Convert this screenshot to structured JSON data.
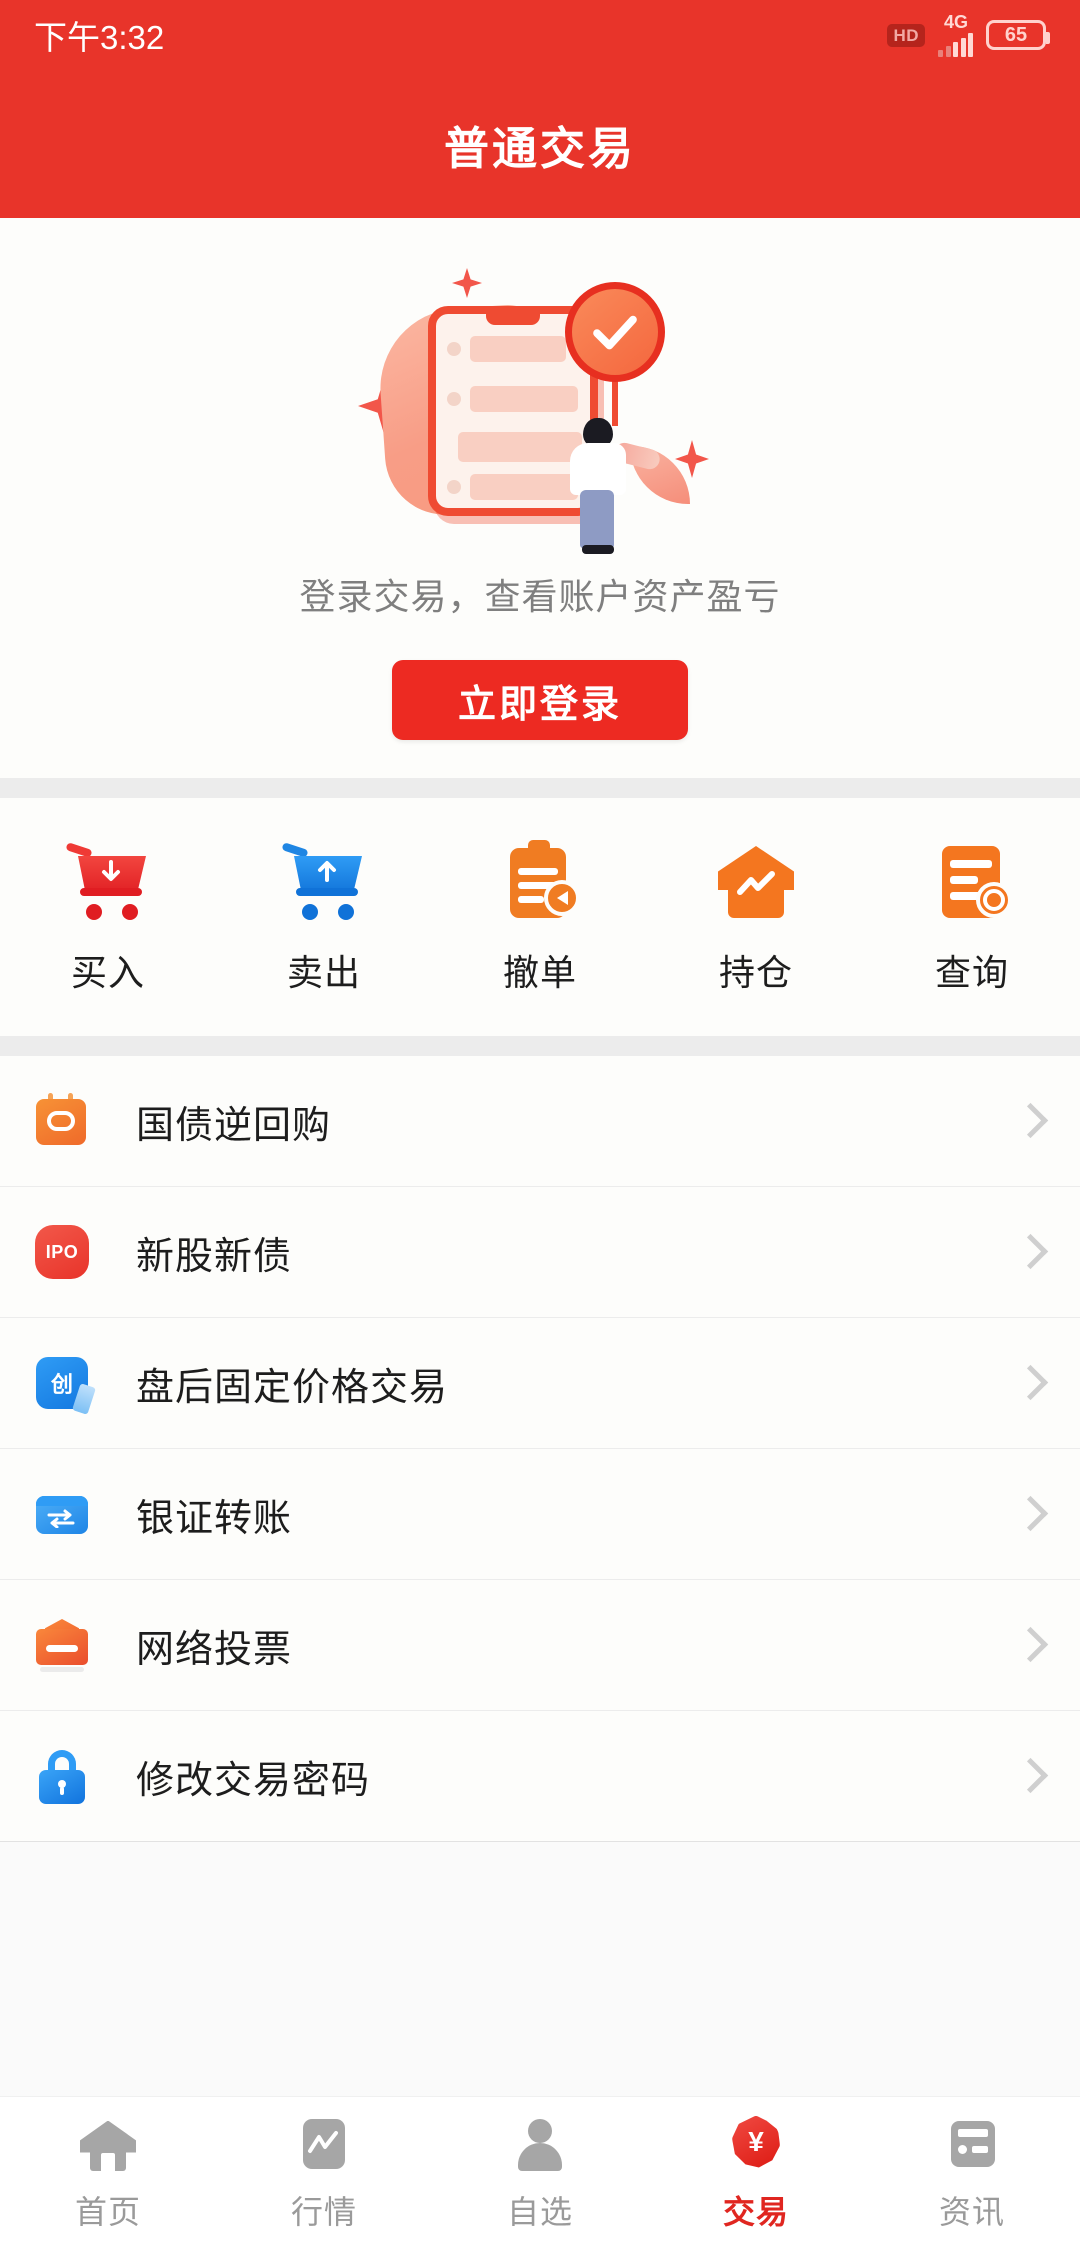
{
  "status_bar": {
    "time": "下午3:32",
    "hd_label": "HD",
    "network": "4G",
    "battery": "65"
  },
  "header": {
    "title": "普通交易"
  },
  "login_card": {
    "subtitle": "登录交易，查看账户资产盈亏",
    "login_button": "立即登录"
  },
  "quick_actions": [
    {
      "label": "买入",
      "icon": "cart-down-icon",
      "color": "#e8342a"
    },
    {
      "label": "卖出",
      "icon": "cart-up-icon",
      "color": "#1a7fe0"
    },
    {
      "label": "撤单",
      "icon": "clipboard-cancel-icon",
      "color": "#f07c22"
    },
    {
      "label": "持仓",
      "icon": "house-chart-icon",
      "color": "#f4761f"
    },
    {
      "label": "查询",
      "icon": "document-search-icon",
      "color": "#f4761f"
    }
  ],
  "menu_items": [
    {
      "label": "国债逆回购",
      "icon": "repo-calendar-icon"
    },
    {
      "label": "新股新债",
      "icon": "ipo-badge-icon",
      "badge_text": "IPO"
    },
    {
      "label": "盘后固定价格交易",
      "icon": "after-hours-icon",
      "badge_text": "创"
    },
    {
      "label": "银证转账",
      "icon": "bank-transfer-icon"
    },
    {
      "label": "网络投票",
      "icon": "vote-box-icon"
    },
    {
      "label": "修改交易密码",
      "icon": "lock-icon"
    }
  ],
  "bottom_nav": [
    {
      "label": "首页",
      "icon": "home-icon",
      "active": false
    },
    {
      "label": "行情",
      "icon": "quote-chart-icon",
      "active": false
    },
    {
      "label": "自选",
      "icon": "person-icon",
      "active": false
    },
    {
      "label": "交易",
      "icon": "yuan-coin-icon",
      "active": true,
      "symbol": "¥"
    },
    {
      "label": "资讯",
      "icon": "news-icon",
      "active": false
    }
  ],
  "colors": {
    "brand_red": "#e8342a",
    "button_red": "#ed2a22",
    "accent_orange": "#f4761f",
    "accent_blue": "#1e85e6",
    "inactive_gray": "#a6a6a6"
  }
}
